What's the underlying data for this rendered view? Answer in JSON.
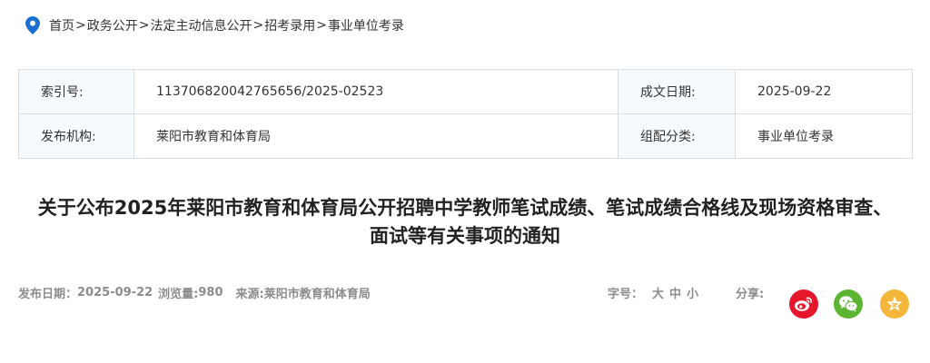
{
  "breadcrumb": {
    "items": [
      "首页",
      "政务公开",
      "法定主动信息公开",
      "招考录用",
      "事业单位考录"
    ],
    "separator": ">"
  },
  "meta": {
    "index_label": "索引号:",
    "index_value": "113706820042765656/2025-02523",
    "date_label": "成文日期:",
    "date_value": "2025-09-22",
    "org_label": "发布机构:",
    "org_value": "莱阳市教育和体育局",
    "category_label": "组配分类:",
    "category_value": "事业单位考录"
  },
  "article": {
    "title_line1": "关于公布2025年莱阳市教育和体育局公开招聘中学教师笔试成绩、笔试成绩合格线及现场资格审查、",
    "title_line2": "面试等有关事项的通知"
  },
  "info": {
    "publish_label": "发布日期：",
    "publish_date": "2025-09-22",
    "views_label": "浏览量:",
    "views_count": "980",
    "source_label": "来源:",
    "source_value": "莱阳市教育和体育局"
  },
  "font_size": {
    "label": "字号：",
    "large": "大",
    "medium": "中",
    "small": "小"
  },
  "share": {
    "label": "分享:",
    "icons": [
      "weibo-icon",
      "wechat-icon",
      "qzone-icon"
    ],
    "colors": {
      "weibo": "#e6162d",
      "wechat": "#5bb531",
      "qzone": "#f4b73b"
    }
  },
  "colors": {
    "pin": "#1a6fd1",
    "key_bg": "#f5fafe",
    "border": "#d8dde3"
  }
}
